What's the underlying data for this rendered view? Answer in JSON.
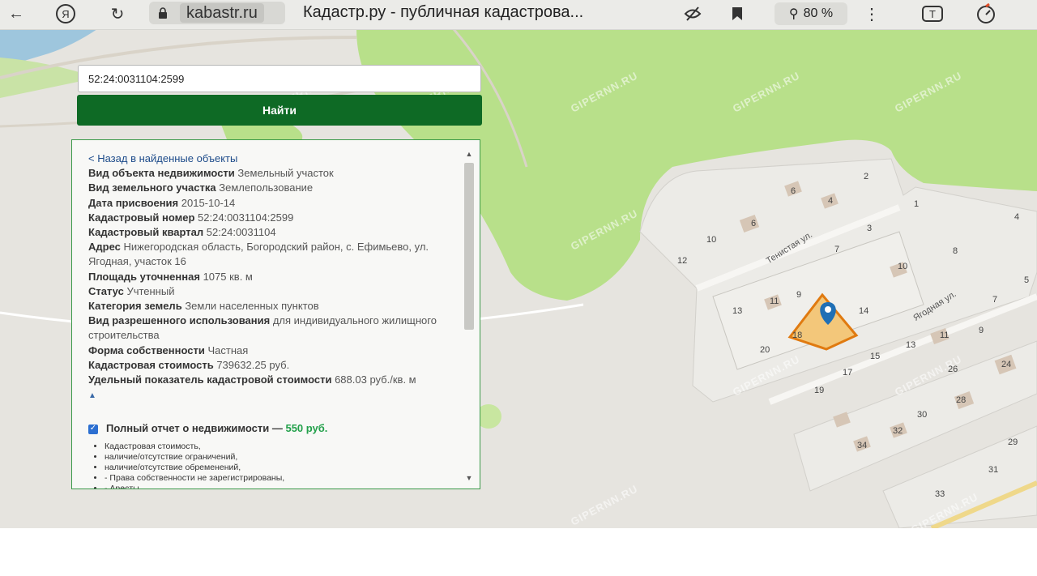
{
  "browser": {
    "domain": "kabastr.ru",
    "page_title": "Кадастр.ру - публичная кадастрова...",
    "zoom": "80 %"
  },
  "search": {
    "value": "52:24:0031104:2599",
    "button_label": "Найти"
  },
  "info": {
    "back_link": "< Назад в найденные объекты",
    "rows": [
      {
        "key": "Вид объекта недвижимости",
        "value": "Земельный участок"
      },
      {
        "key": "Вид земельного участка",
        "value": "Землепользование"
      },
      {
        "key": "Дата присвоения",
        "value": "2015-10-14"
      },
      {
        "key": "Кадастровый номер",
        "value": "52:24:0031104:2599"
      },
      {
        "key": "Кадастровый квартал",
        "value": "52:24:0031104"
      },
      {
        "key": "Адрес",
        "value": "Нижегородская область, Богородский район, с. Ефимьево, ул. Ягодная, участок 16"
      },
      {
        "key": "Площадь уточненная",
        "value": "1075 кв. м"
      },
      {
        "key": "Статус",
        "value": "Учтенный"
      },
      {
        "key": "Категория земель",
        "value": "Земли населенных пунктов"
      },
      {
        "key": "Вид разрешенного использования",
        "value": "для индивидуального жилищного строительства"
      },
      {
        "key": "Форма собственности",
        "value": "Частная"
      },
      {
        "key": "Кадастровая стоимость",
        "value": "739632.25 руб."
      },
      {
        "key": "Удельный показатель кадастровой стоимости",
        "value": "688.03 руб./кв. м"
      }
    ],
    "report": {
      "title": "Полный отчет о недвижимости —",
      "price": "550 руб.",
      "items": [
        "Кадастровая стоимость,",
        "наличие/отсутствие ограничений,",
        "наличие/отсутствие обременений,",
        "- Права собственности не зарегистрированы,",
        "- Аресты,"
      ]
    }
  },
  "map": {
    "streets": [
      "Тенистая ул.",
      "Ягодная ул."
    ],
    "lot_numbers": [
      "2",
      "6",
      "4",
      "1",
      "3",
      "8",
      "10",
      "12",
      "7",
      "10",
      "4",
      "6",
      "5",
      "9",
      "11",
      "14",
      "13",
      "18",
      "20",
      "13",
      "15",
      "11",
      "9",
      "7",
      "17",
      "19",
      "26",
      "24",
      "28",
      "30",
      "32",
      "34",
      "29",
      "31",
      "33"
    ],
    "watermark": "GIPERNN.RU"
  },
  "colors": {
    "accent_green": "#0e6a25",
    "panel_border": "#3c9a4a",
    "parcel_outline": "#e07a10",
    "marker": "#1f6fb5",
    "forest": "#b8e08a"
  }
}
